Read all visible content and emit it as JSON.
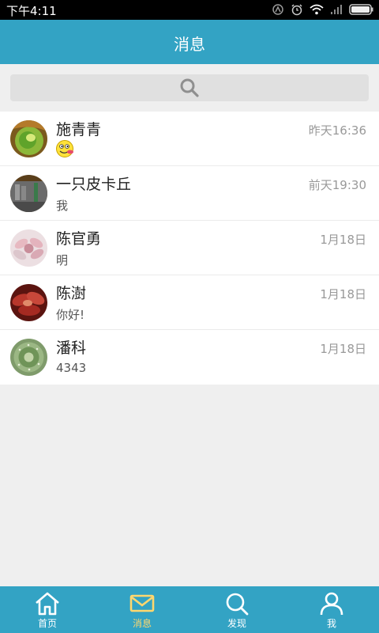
{
  "status_bar": {
    "time": "下午4:11"
  },
  "header": {
    "title": "消息"
  },
  "search": {
    "icon": "search-icon"
  },
  "conversations": [
    {
      "name": "施青青",
      "message": "",
      "message_icon": "smiley-emoji-icon",
      "time": "昨天16:36",
      "avatar": "green-succulent-avatar"
    },
    {
      "name": "一只皮卡丘",
      "message": "我",
      "time": "前天19:30",
      "avatar": "building-photo-avatar"
    },
    {
      "name": "陈官勇",
      "message": "明",
      "time": "1月18日",
      "avatar": "pink-flower-avatar"
    },
    {
      "name": "陈澍",
      "message": "你好!",
      "time": "1月18日",
      "avatar": "red-succulent-avatar"
    },
    {
      "name": "潘科",
      "message": "4343",
      "time": "1月18日",
      "avatar": "green-cactus-avatar"
    }
  ],
  "bottom_nav": {
    "active_index": 1,
    "items": [
      {
        "label": "首页",
        "icon": "home-icon"
      },
      {
        "label": "消息",
        "icon": "mail-icon"
      },
      {
        "label": "发现",
        "icon": "search-icon"
      },
      {
        "label": "我",
        "icon": "user-icon"
      }
    ]
  },
  "colors": {
    "header": "#33a3c4",
    "nav_active": "#ffd76e",
    "background": "#efefef"
  }
}
